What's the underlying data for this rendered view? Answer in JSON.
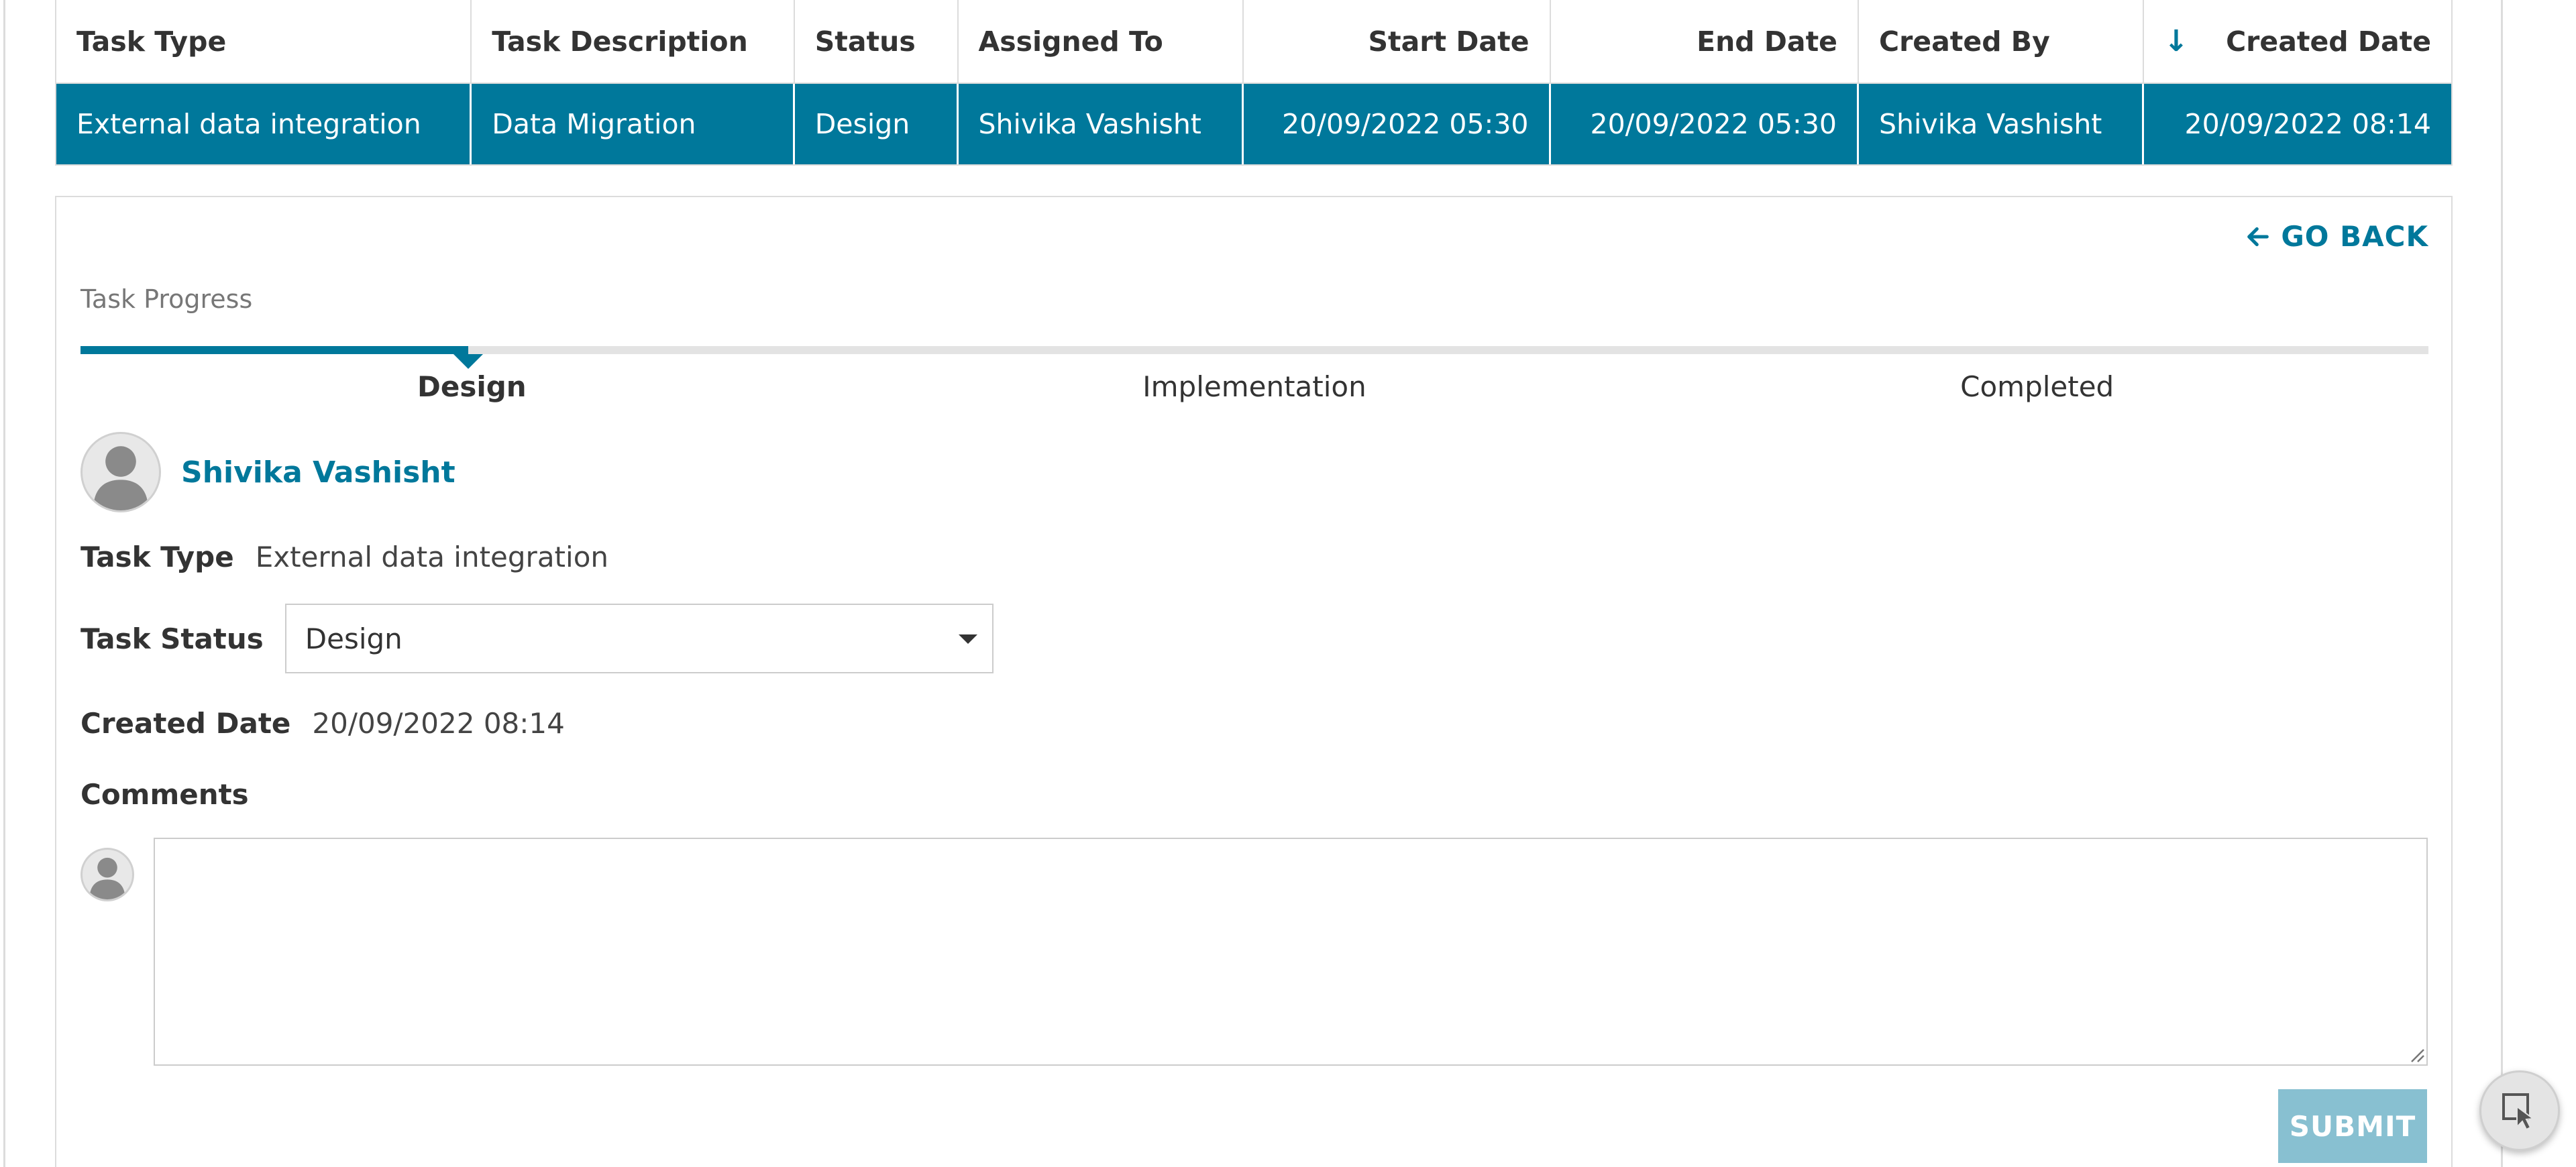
{
  "table": {
    "columns": [
      "Task Type",
      "Task Description",
      "Status",
      "Assigned To",
      "Start Date",
      "End Date",
      "Created By",
      "Created Date"
    ],
    "sort_indicator": "↓",
    "row": [
      "External data integration",
      "Data Migration",
      "Design",
      "Shivika Vashisht",
      "20/09/2022 05:30",
      "20/09/2022 05:30",
      "Shivika Vashisht",
      "20/09/2022 08:14"
    ]
  },
  "detail": {
    "go_back_label": "GO BACK",
    "progress_label": "Task Progress",
    "progress_fraction": 0.165,
    "steps": [
      "Design",
      "Implementation",
      "Completed"
    ],
    "active_step": "Design",
    "user_name": "Shivika Vashisht",
    "task_type_label": "Task Type",
    "task_type_value": "External data integration",
    "task_status_label": "Task Status",
    "task_status_value": "Design",
    "created_date_label": "Created Date",
    "created_date_value": "20/09/2022 08:14",
    "comments_label": "Comments",
    "comment_value": "",
    "submit_label": "SUBMIT"
  },
  "colors": {
    "accent": "#00789b",
    "submit_disabled": "#88c0d1",
    "border": "#dcdcdc"
  },
  "icons": {
    "go_back": "arrow-left-icon",
    "avatar": "user-silhouette-icon",
    "dropdown": "caret-down-icon",
    "fab": "cursor-select-icon"
  }
}
